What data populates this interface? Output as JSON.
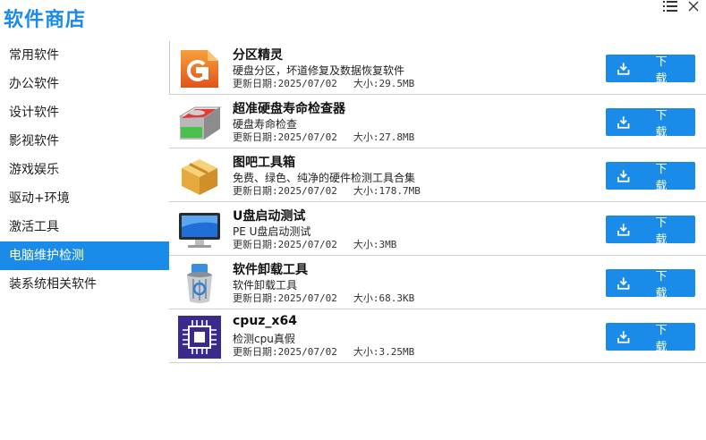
{
  "app": {
    "title": "软件商店"
  },
  "sidebar": {
    "items": [
      {
        "label": "常用软件"
      },
      {
        "label": "办公软件"
      },
      {
        "label": "设计软件"
      },
      {
        "label": "影视软件"
      },
      {
        "label": "游戏娱乐"
      },
      {
        "label": "驱动+环境"
      },
      {
        "label": "激活工具"
      },
      {
        "label": "电脑维护检测",
        "active": true
      },
      {
        "label": "装系统相关软件"
      }
    ]
  },
  "apps": [
    {
      "name": "分区精灵",
      "desc": "硬盘分区，坏道修复及数据恢复软件",
      "date": "更新日期:2025/07/02",
      "size": "大小:29.5MB",
      "icon": "partition-wizard-icon",
      "button": "下载"
    },
    {
      "name": "超准硬盘寿命检查器",
      "desc": "硬盘寿命检查",
      "date": "更新日期:2025/07/02",
      "size": "大小:27.8MB",
      "icon": "hard-disk-icon",
      "button": "下载"
    },
    {
      "name": "图吧工具箱",
      "desc": "免费、绿色、纯净的硬件检测工具合集",
      "date": "更新日期:2025/07/02",
      "size": "大小:178.7MB",
      "icon": "toolbox-box-icon",
      "button": "下载"
    },
    {
      "name": "U盘启动测试",
      "desc": "PE U盘启动测试",
      "date": "更新日期:2025/07/02",
      "size": "大小:3MB",
      "icon": "monitor-icon",
      "button": "下载"
    },
    {
      "name": "软件卸载工具",
      "desc": "软件卸载工具",
      "date": "更新日期:2025/07/02",
      "size": "大小:68.3KB",
      "icon": "recycle-bin-icon",
      "button": "下载"
    },
    {
      "name": "cpuz_x64",
      "desc": "检测cpu真假",
      "date": "更新日期:2025/07/02",
      "size": "大小:3.25MB",
      "icon": "cpu-chip-icon",
      "button": "下载"
    }
  ],
  "colors": {
    "accent": "#1a8be8",
    "active_bg": "#1a8be8"
  }
}
